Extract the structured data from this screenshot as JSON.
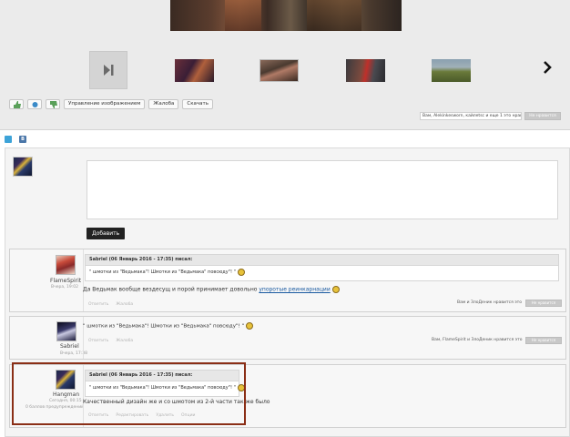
{
  "gallery": {
    "toolbar": {
      "manage_label": "Управление изображением",
      "complain_label": "Жалоба",
      "download_label": "Скачать"
    },
    "likes_text": "Вам, Alekinkesworn, кайлеtsс и еще 1 это нравится",
    "dislike_label": "Не нравится",
    "icons": [
      "play-skip-icon",
      "chevron-right-icon",
      "thumb-up-icon",
      "thumb-down-icon",
      "share-icon"
    ]
  },
  "social": {
    "tw": "",
    "vk": "В"
  },
  "compose": {
    "placeholder": "",
    "add_label": "Добавить"
  },
  "comments": [
    {
      "user": "FlameSpirit",
      "date": "Вчера, 19:02",
      "quote_head": "Sabriel (06 Январь 2016 - 17:35) писал:",
      "quote_body": "\" шмотки из \"Ведьмака\"! Шмотки из \"Ведьмака\" повсюду\"! \"",
      "text": "Да Ведьмак вообще вездесущ и порой принимает довольно",
      "link": "упоротые реинкарнации",
      "actions": [
        "Ответить",
        "Жалоба"
      ],
      "likes": "Вам и ЗлоДеник нравится это",
      "dislike": "Не нравится"
    },
    {
      "user": "Sabriel",
      "date": "Вчера, 17:38",
      "text": "\" шмотки из \"Ведьмака\"! Шмотки из \"Ведьмака\" повсюду\"! \"",
      "actions": [
        "Ответить",
        "Жалоба"
      ],
      "likes": "Вам, FlameSpirit и ЗлоДеник нравится это",
      "dislike": "Не нравится"
    },
    {
      "user": "Hangman",
      "date": "Сегодня, 00:15",
      "warn": "0 баллов предупреждений",
      "quote_head": "Sabriel (06 Январь 2016 - 17:35) писал:",
      "quote_body": "\" шмотки из \"Ведьмака\"! Шмотки из \"Ведьмака\" повсюду\"! \"",
      "text": "Качественный дизайн же и со шмотом из 2-й части так же было",
      "actions": [
        "Ответить",
        "Редактировать",
        "Удалить",
        "Опции"
      ]
    }
  ]
}
